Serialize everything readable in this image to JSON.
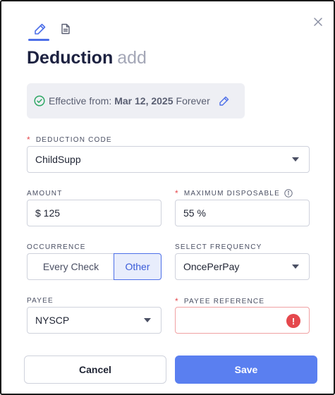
{
  "tabs": [
    {
      "icon": "pencil-icon",
      "active": true
    },
    {
      "icon": "document-icon",
      "active": false
    }
  ],
  "title": {
    "main": "Deduction",
    "sub": "add"
  },
  "effective": {
    "prefix": "Effective from:",
    "date": "Mar 12, 2025",
    "suffix": "Forever"
  },
  "fields": {
    "deduction_code": {
      "label": "DEDUCTION CODE",
      "required": true,
      "value": "ChildSupp"
    },
    "amount": {
      "label": "AMOUNT",
      "required": false,
      "value": "$ 125"
    },
    "maximum_disposable": {
      "label": "MAXIMUM DISPOSABLE",
      "required": true,
      "value": "55 %"
    },
    "occurrence": {
      "label": "OCCURRENCE",
      "options": [
        "Every Check",
        "Other"
      ],
      "selected": "Other"
    },
    "select_frequency": {
      "label": "SELECT FREQUENCY",
      "required": false,
      "value": "OncePerPay"
    },
    "payee": {
      "label": "PAYEE",
      "required": false,
      "value": "NYSCP"
    },
    "payee_reference": {
      "label": "PAYEE REFERENCE",
      "required": true,
      "value": "",
      "error": true
    }
  },
  "required_mark": "*",
  "error_glyph": "!",
  "buttons": {
    "cancel": "Cancel",
    "save": "Save"
  },
  "colors": {
    "accent": "#4d6fe8",
    "save_button": "#5a7ff0",
    "title": "#1c2140",
    "error": "#e5484d",
    "success": "#2fa865",
    "effective_bg": "#eeeff4"
  }
}
